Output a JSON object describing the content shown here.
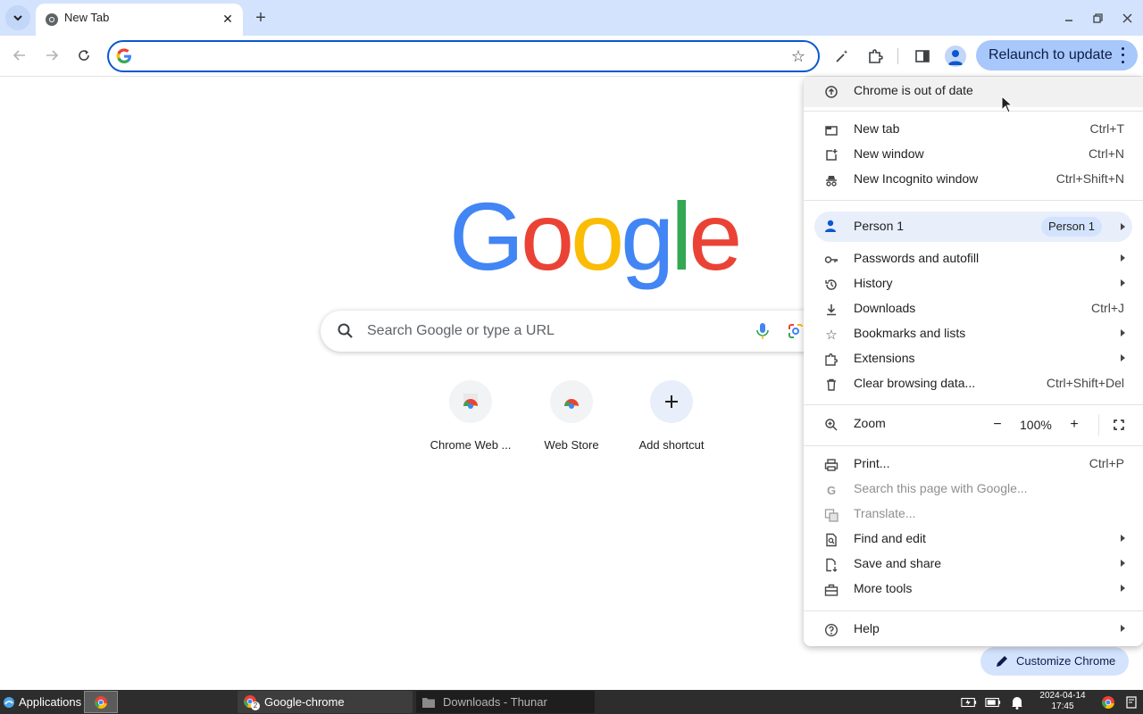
{
  "browser": {
    "tab": {
      "title": "New Tab"
    },
    "relaunch_label": "Relaunch to update",
    "omnibox_value": ""
  },
  "ntp": {
    "search_placeholder": "Search Google or type a URL",
    "shortcuts": [
      {
        "label": "Chrome Web ..."
      },
      {
        "label": "Web Store"
      },
      {
        "label": "Add shortcut"
      }
    ],
    "customize_label": "Customize Chrome"
  },
  "menu": {
    "out_of_date": "Chrome is out of date",
    "new_tab": {
      "label": "New tab",
      "shortcut": "Ctrl+T"
    },
    "new_window": {
      "label": "New window",
      "shortcut": "Ctrl+N"
    },
    "new_incognito": {
      "label": "New Incognito window",
      "shortcut": "Ctrl+Shift+N"
    },
    "person": {
      "label": "Person 1",
      "chip": "Person 1"
    },
    "passwords": {
      "label": "Passwords and autofill"
    },
    "history": {
      "label": "History"
    },
    "downloads": {
      "label": "Downloads",
      "shortcut": "Ctrl+J"
    },
    "bookmarks": {
      "label": "Bookmarks and lists"
    },
    "extensions": {
      "label": "Extensions"
    },
    "clear_data": {
      "label": "Clear browsing data...",
      "shortcut": "Ctrl+Shift+Del"
    },
    "zoom": {
      "label": "Zoom",
      "value": "100%"
    },
    "print": {
      "label": "Print...",
      "shortcut": "Ctrl+P"
    },
    "search_page": {
      "label": "Search this page with Google..."
    },
    "translate": {
      "label": "Translate..."
    },
    "find_edit": {
      "label": "Find and edit"
    },
    "save_share": {
      "label": "Save and share"
    },
    "more_tools": {
      "label": "More tools"
    },
    "help": {
      "label": "Help"
    }
  },
  "taskbar": {
    "applications_label": "Applications",
    "tasks": [
      {
        "label": "Google-chrome",
        "badge": "2"
      },
      {
        "label": "Downloads - Thunar"
      }
    ],
    "clock": {
      "date": "2024-04-14",
      "time": "17:45"
    }
  },
  "colors": {
    "accent": "#0b57d0",
    "titlebar": "#d3e3fd",
    "relaunch_bg": "#a8c7fa",
    "google_blue": "#4285f4",
    "google_red": "#ea4335",
    "google_yellow": "#fbbc05",
    "google_green": "#34a853"
  }
}
